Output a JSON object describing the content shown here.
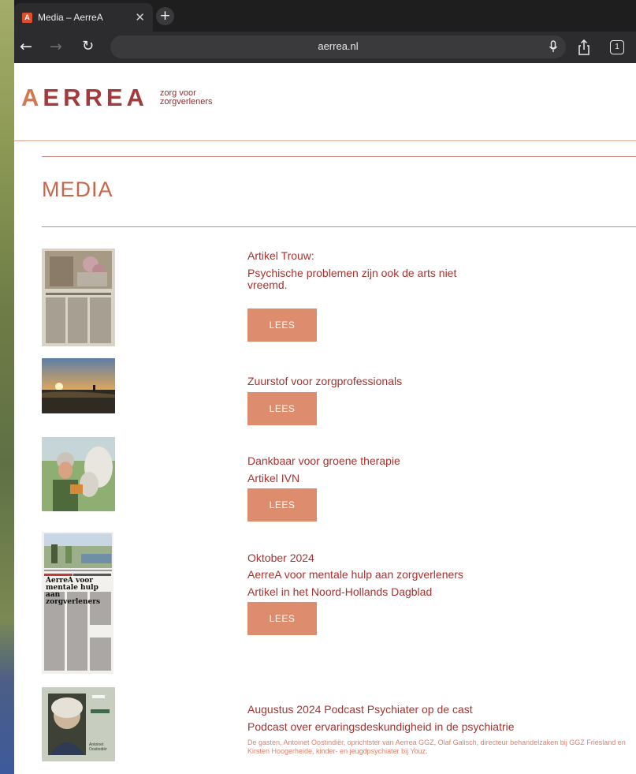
{
  "browser": {
    "tab_title": "Media – AerreA",
    "tab_close": "✕",
    "new_tab": "+",
    "url": "aerrea.nl",
    "tabs_count": "1"
  },
  "header": {
    "logo_text": "AERREA",
    "tagline_1": "zorg voor",
    "tagline_2": "zorgverleners"
  },
  "page_title": "MEDIA",
  "entries": [
    {
      "title": "Artikel Trouw:",
      "line2": "Psychische problemen zijn ook de arts niet",
      "line3": "vreemd.",
      "button": "LEES"
    },
    {
      "title": "Zuurstof voor zorgprofessionals",
      "button": "LEES"
    },
    {
      "title": "Dankbaar voor groene therapie",
      "line2": "Artikel IVN",
      "button": "LEES"
    },
    {
      "title": "Oktober 2024",
      "line2": "AerreA voor mentale hulp aan zorgverleners",
      "line3": "Artikel in het Noord-Hollands Dagblad",
      "button": "LEES",
      "thumb_headline": "AerreA voor mentale hulp aan zorgverleners"
    },
    {
      "title": "Augustus 2024 Podcast Psychiater op de cast",
      "line2": "Podcast over ervaringsdeskundigheid in de psychiatrie",
      "desc": "De gasten, Antoinet Oostindiër, oprichtster van Aerrea GGZ, Olaf Galisch, directeur behandelzaken bij GGZ Friesland en Kirsten Hoogerheide, kinder- en jeugdpsychiater bij Youz.",
      "thumb_caption": "Antoinet Oostindiër"
    }
  ],
  "colors": {
    "brand": "#a8322f",
    "accent": "#dd8c6d",
    "title": "#c9664a"
  }
}
